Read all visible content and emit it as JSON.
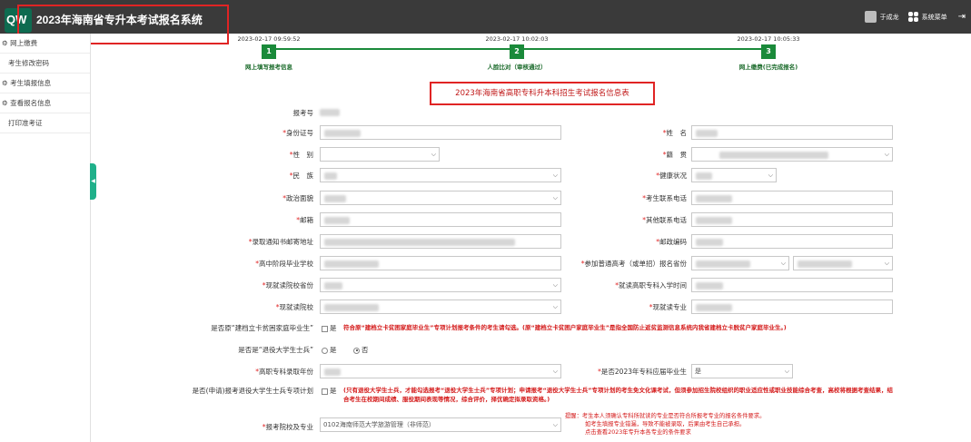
{
  "header": {
    "logo_text": "QW",
    "title": "2023年海南省专升本考试报名系统",
    "user_name": "于成龙",
    "menu_label": "系统菜单",
    "exit_glyph": "⇥"
  },
  "sidebar": {
    "items": [
      {
        "label": "网上缴费",
        "icon": "gear-icon"
      },
      {
        "label": "考生修改密码",
        "icon": ""
      },
      {
        "label": "考生填报信息",
        "icon": "gear-icon"
      },
      {
        "label": "查看报名信息",
        "icon": "gear-icon"
      },
      {
        "label": "打印准考证",
        "icon": ""
      }
    ],
    "collapse_glyph": "◀"
  },
  "steps": [
    {
      "time": "2023-02-17 09:59:52",
      "num": "1",
      "label": "网上填写报考信息"
    },
    {
      "time": "2023-02-17 10:02:03",
      "num": "2",
      "label": "人脸比对（审核通过）"
    },
    {
      "time": "2023-02-17 10:05:33",
      "num": "3",
      "label": "网上缴费(已完成报名)"
    }
  ],
  "form": {
    "title": "2023年海南省高职专科升本科招生考试报名信息表",
    "labels": {
      "exam_no": "报考号",
      "id_card": "身份证号",
      "name": "姓　名",
      "gender": "性　别",
      "native": "籍　贯",
      "ethnic": "民　族",
      "health": "健康状况",
      "political": "政治面貌",
      "phone": "考生联系电话",
      "email": "邮箱",
      "other_phone": "其他联系电话",
      "address": "录取通知书邮寄地址",
      "postcode": "邮政编码",
      "high_school": "高中阶段毕业学校",
      "gaokao_prov": "参加普通高考（或单招）报名省份",
      "school_prov": "现就读院校省份",
      "enroll_time": "就读高职专科入学时间",
      "school": "现就读院校",
      "major": "现就读专业",
      "poverty_q": "是否原“建档立卡贫困家庭毕业生”",
      "veteran_q": "是否是“退役大学生士兵”",
      "admit_year": "高职专科录取年份",
      "graduate_q": "是否2023年专科应届毕业生",
      "veteran_plan_q": "是否(申请)报考退役大学生士兵专项计划",
      "apply": "报考院校及专业"
    },
    "values": {
      "graduate": "是",
      "apply": "0102海南师范大学旅游管理（非师范）"
    },
    "options": {
      "no": "否",
      "yes": "是"
    },
    "poverty_note": "符合原“建档立卡贫困家庭毕业生”专项计划报考条件的考生请勾选。(原“建档立卡贫困户家庭毕业生”是指全国防止返贫监测信息系统内我省建档立卡脱贫户家庭毕业生。)",
    "veteran_plan_note": "(只有退役大学生士兵，才能勾选报考“退役大学生士兵”专项计划；申请报考“退役大学生士兵”专项计划的考生免文化课考试，但须参加招生院校组织的职业适应性或职业技能综合考查，高校将根据考查结果，结合考生在校期间成绩、服役期间表现等情况，综合评价，择优确定拟录取资格。)",
    "tips": [
      "提醒：考生本人须确认专科所就读的专业是否符合所报考专业的报名条件要求。",
      "如考生填报专业错漏，导致不能被录取，后果由考生自己承担。",
      "点击查看2023年专升本各专业的条件要求"
    ]
  }
}
